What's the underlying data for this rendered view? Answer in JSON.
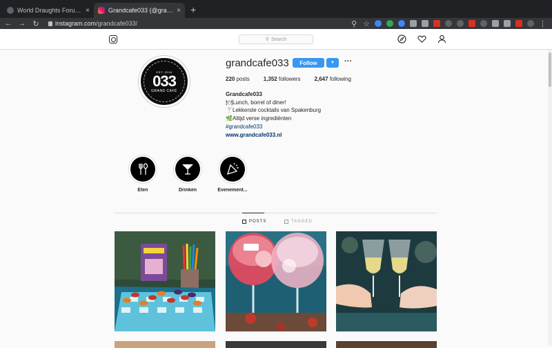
{
  "browser": {
    "tabs": [
      {
        "title": "World Draughts Forum - Index p",
        "close": "×"
      },
      {
        "title": "Grandcafe033 (@grandcafe033)",
        "close": "×"
      }
    ],
    "new_tab": "+",
    "url_host": "instagram.com",
    "url_path": "/grandcafe033/"
  },
  "header": {
    "search_placeholder": "Search",
    "icons": [
      "instagram-logo-icon",
      "compass-icon",
      "heart-icon",
      "user-icon"
    ]
  },
  "profile": {
    "username": "grandcafe033",
    "follow_label": "Follow",
    "dropdown_label": "▼",
    "more_label": "···",
    "avatar": {
      "est": "EST. 2016",
      "number": "033",
      "subtitle": "GRAND CAFÉ"
    },
    "stats": {
      "posts_count": "220",
      "posts_label": "posts",
      "followers_count": "1,352",
      "followers_label": "followers",
      "following_count": "2,647",
      "following_label": "following"
    },
    "bio": {
      "name": "Grandcafe033",
      "line1": "Lunch, borrel of diner!",
      "line2": "Lekkerste cocktails van Spakenburg",
      "line3": "Altijd verse ingrediënten",
      "hashtag": "#grandcafe033",
      "website": "www.grandcafe033.nl"
    }
  },
  "highlights": [
    {
      "label": "Eten",
      "icon": "fork-spoon-icon"
    },
    {
      "label": "Drinken",
      "icon": "cocktail-icon"
    },
    {
      "label": "Evenement...",
      "icon": "party-icon"
    }
  ],
  "tabs": {
    "posts": "POSTS",
    "tagged": "TAGGED"
  },
  "colors": {
    "accent": "#3897f0",
    "link": "#003569"
  }
}
